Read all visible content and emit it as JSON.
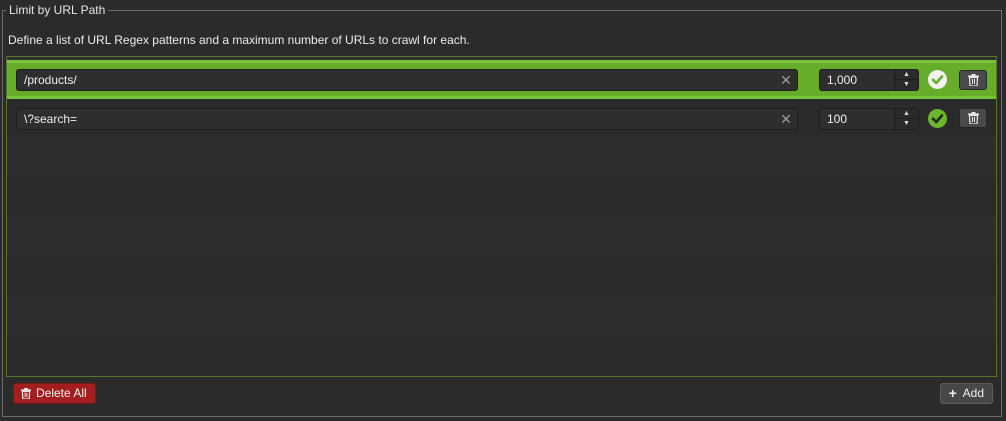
{
  "section": {
    "legend": "Limit by URL Path",
    "description": "Define a list of URL Regex patterns and a maximum number of URLs to crawl for each."
  },
  "rows": [
    {
      "pattern": "/products/",
      "max_urls": "1,000",
      "selected": true,
      "valid": true
    },
    {
      "pattern": "\\?search=",
      "max_urls": "100",
      "selected": false,
      "valid": true
    }
  ],
  "footer": {
    "delete_all_label": "Delete All",
    "add_label": "Add"
  },
  "icons": {
    "clear": "close-icon",
    "valid": "check-circle-icon",
    "delete": "trash-icon",
    "add": "plus-icon",
    "stepper_up": "chevron-up-icon",
    "stepper_down": "chevron-down-icon"
  },
  "colors": {
    "selected_row": "#66ad2a",
    "valid_check": "#6cb52d",
    "delete_all": "#a31f1f",
    "panel_border": "#56752e"
  }
}
